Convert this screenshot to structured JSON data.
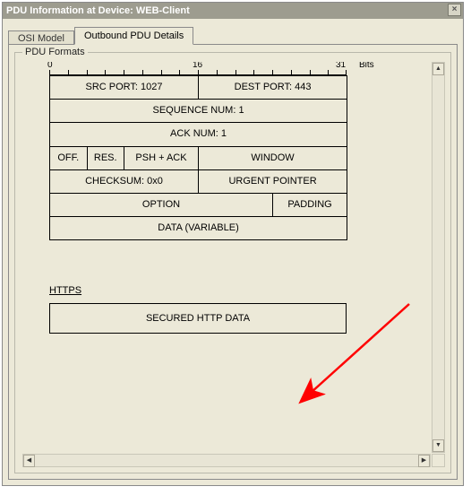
{
  "window": {
    "title": "PDU Information at Device: WEB-Client",
    "close": "×"
  },
  "tabs": {
    "osi": "OSI Model",
    "outbound": "Outbound PDU Details"
  },
  "groupbox": {
    "title": "PDU Formats"
  },
  "ruler": {
    "t0": "0",
    "t16": "16",
    "t31": "31",
    "bits": "Bits"
  },
  "tcp": {
    "src": "SRC PORT: 1027",
    "dst": "DEST PORT: 443",
    "seq": "SEQUENCE NUM: 1",
    "ack": "ACK NUM: 1",
    "off": "OFF.",
    "res": "RES.",
    "flags": "PSH + ACK",
    "win": "WINDOW",
    "chk": "CHECKSUM: 0x0",
    "urg": "URGENT POINTER",
    "opt": "OPTION",
    "pad": "PADDING",
    "data": "DATA (VARIABLE)"
  },
  "https": {
    "label": "HTTPS",
    "data": "SECURED HTTP DATA"
  },
  "scroll": {
    "up": "▲",
    "down": "▼",
    "left": "◀",
    "right": "▶"
  }
}
